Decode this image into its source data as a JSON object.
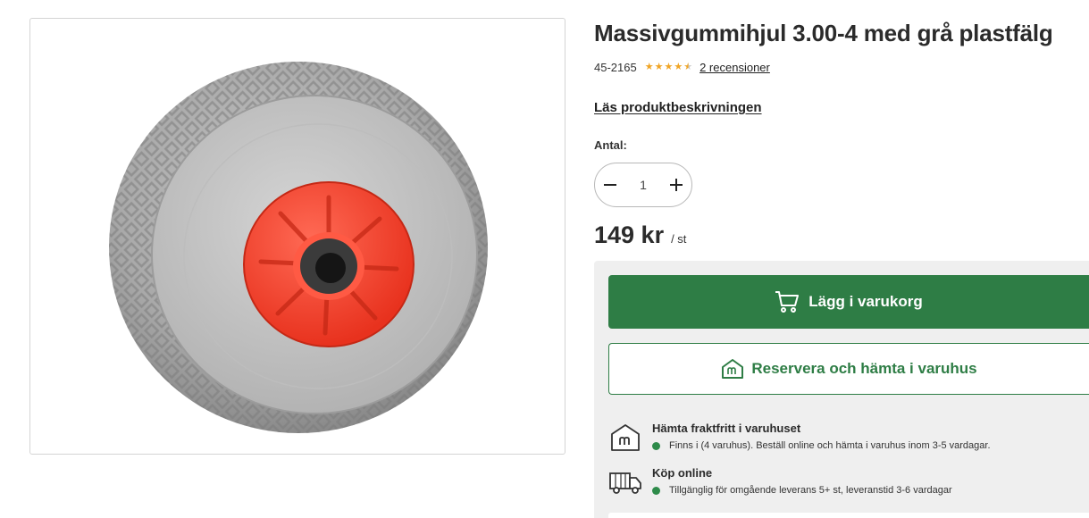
{
  "product": {
    "title": "Massivgummihjul 3.00-4 med grå plastfälg",
    "sku": "45-2165",
    "rating": 4.5,
    "reviews_link": "2 recensioner",
    "description_link": "Läs produktbeskrivningen",
    "image_alt": "Massivgummihjul med röd fälg"
  },
  "quantity": {
    "label": "Antal:",
    "value": "1",
    "decrement_icon": "minus-icon",
    "increment_icon": "plus-icon"
  },
  "price": {
    "amount": "149 kr",
    "unit": "/ st"
  },
  "actions": {
    "add_to_cart": "Lägg i varukorg",
    "reserve": "Reservera och hämta i varuhus"
  },
  "availability": [
    {
      "icon": "store-icon",
      "title": "Hämta fraktfritt i varuhuset",
      "status": "Finns i (4 varuhus). Beställ online och hämta i varuhus inom 3-5 vardagar."
    },
    {
      "icon": "truck-icon",
      "title": "Köp online",
      "status": "Tillgänglig för omgående leverans 5+ st, leveranstid 3-6 vardagar"
    }
  ],
  "colors": {
    "primary_green": "#2e7d45",
    "status_green": "#2e8b4a",
    "star_gold": "#f0a526",
    "panel_gray": "#efefef"
  }
}
